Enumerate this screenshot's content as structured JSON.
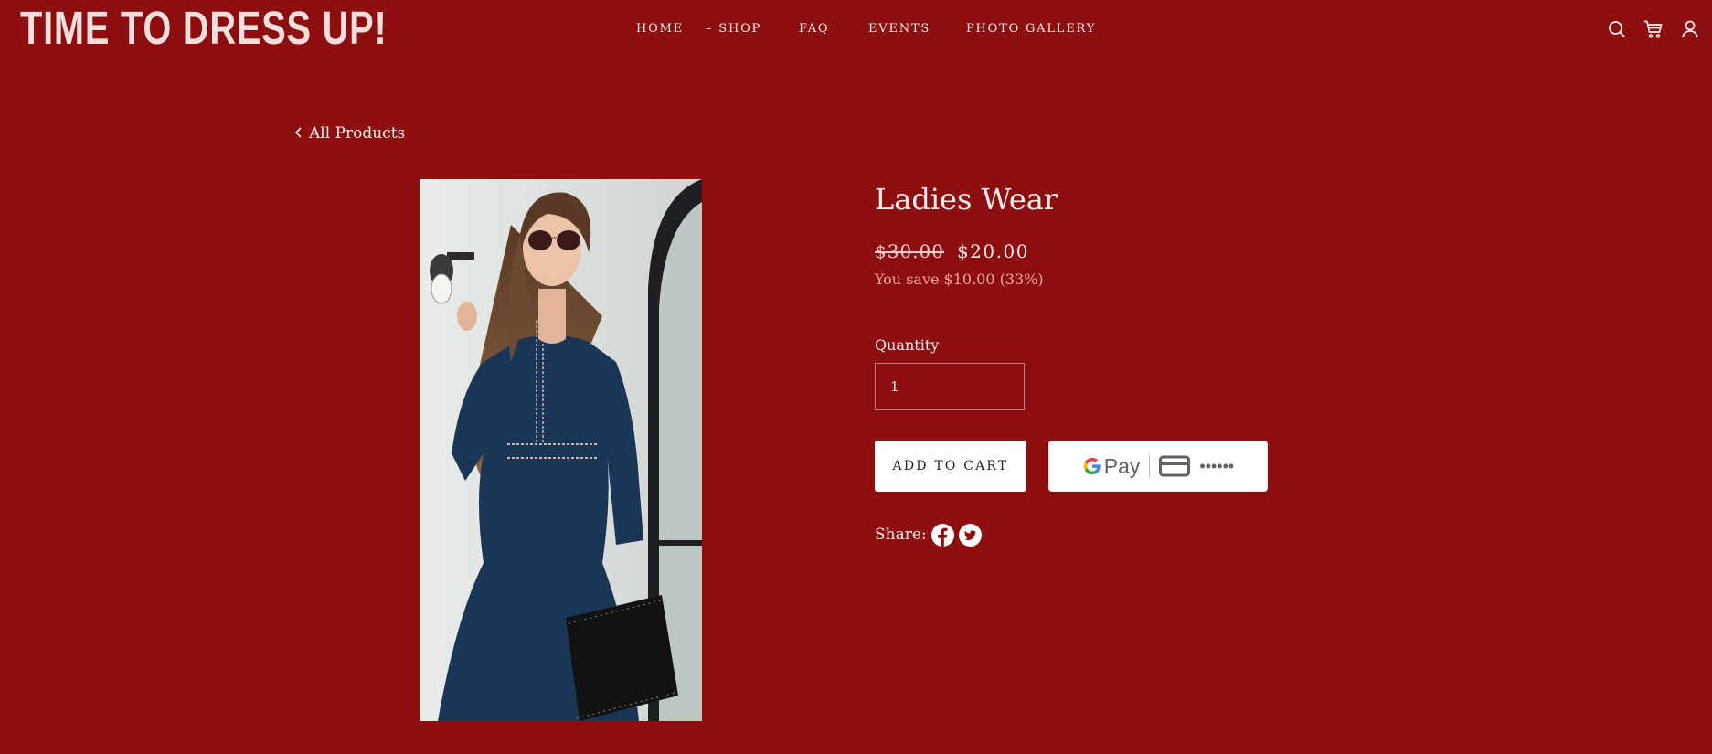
{
  "header": {
    "site_title": "TIME TO DRESS UP!",
    "nav": [
      {
        "label": "HOME"
      },
      {
        "label": "– SHOP"
      },
      {
        "label": "FAQ"
      },
      {
        "label": "EVENTS"
      },
      {
        "label": "PHOTO GALLERY"
      }
    ],
    "icons": [
      "search-icon",
      "cart-icon",
      "account-icon"
    ]
  },
  "back_link": {
    "label": "All Products"
  },
  "product": {
    "title": "Ladies Wear",
    "price_original": "$30.00",
    "price_sale": "$20.00",
    "savings": "You save $10.00 (33%)",
    "quantity_label": "Quantity",
    "quantity_value": "1",
    "add_to_cart_label": "ADD TO CART",
    "gpay_label": "Pay",
    "gpay_card_mask": "••••••",
    "share_label": "Share:",
    "share_icons": [
      "facebook-icon",
      "twitter-icon"
    ]
  },
  "colors": {
    "background": "#8c0e0f",
    "text": "#fbecec",
    "savings": "#f1a9a4",
    "button_bg": "#ffffff"
  }
}
